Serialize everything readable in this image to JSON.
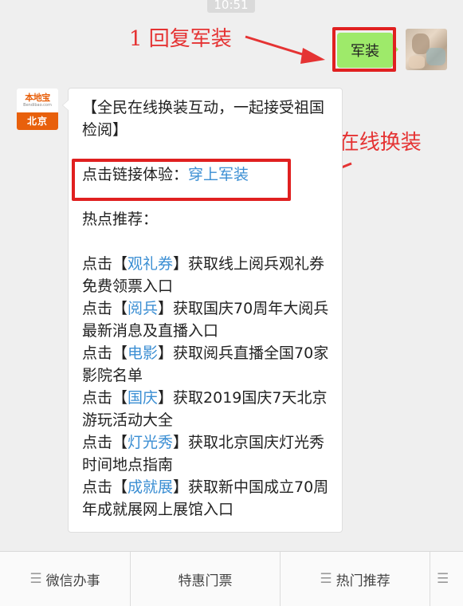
{
  "timestamp": "10:51",
  "sent_message": "军装",
  "annotations": [
    {
      "text": "1 回复军装"
    },
    {
      "text": "2 在线换装"
    }
  ],
  "account": {
    "logo_name": "本地宝",
    "logo_domain": "Bendibao.com",
    "logo_city": "北京"
  },
  "message": {
    "intro": "【全民在线换装互动，一起接受祖国检阅】",
    "experience_prefix": "点击链接体验：",
    "experience_link": "穿上军装",
    "hot_title": "热点推荐：",
    "items": [
      {
        "prefix": "点击【",
        "link": "观礼券",
        "suffix": "】获取线上阅兵观礼券免费领票入口"
      },
      {
        "prefix": "点击【",
        "link": "阅兵",
        "suffix": "】获取国庆70周年大阅兵最新消息及直播入口"
      },
      {
        "prefix": "点击【",
        "link": "电影",
        "suffix": "】获取阅兵直播全国70家影院名单"
      },
      {
        "prefix": "点击【",
        "link": "国庆",
        "suffix": "】获取2019国庆7天北京游玩活动大全"
      },
      {
        "prefix": "点击【",
        "link": "灯光秀",
        "suffix": "】获取北京国庆灯光秀时间地点指南"
      },
      {
        "prefix": "点击【",
        "link": "成就展",
        "suffix": "】获取新中国成立70周年成就展网上展馆入口"
      }
    ]
  },
  "menu": [
    {
      "label": "微信办事",
      "icon": "hamburger-icon"
    },
    {
      "label": "特惠门票",
      "icon": ""
    },
    {
      "label": "热门推荐",
      "icon": "hamburger-icon"
    },
    {
      "label": "",
      "icon": "hamburger-icon"
    }
  ],
  "colors": {
    "background": "#efefef",
    "sent_bubble": "#9eea6a",
    "annotation_red": "#e53333",
    "link_blue": "#3a8ed3",
    "logo_orange": "#e8600c"
  }
}
